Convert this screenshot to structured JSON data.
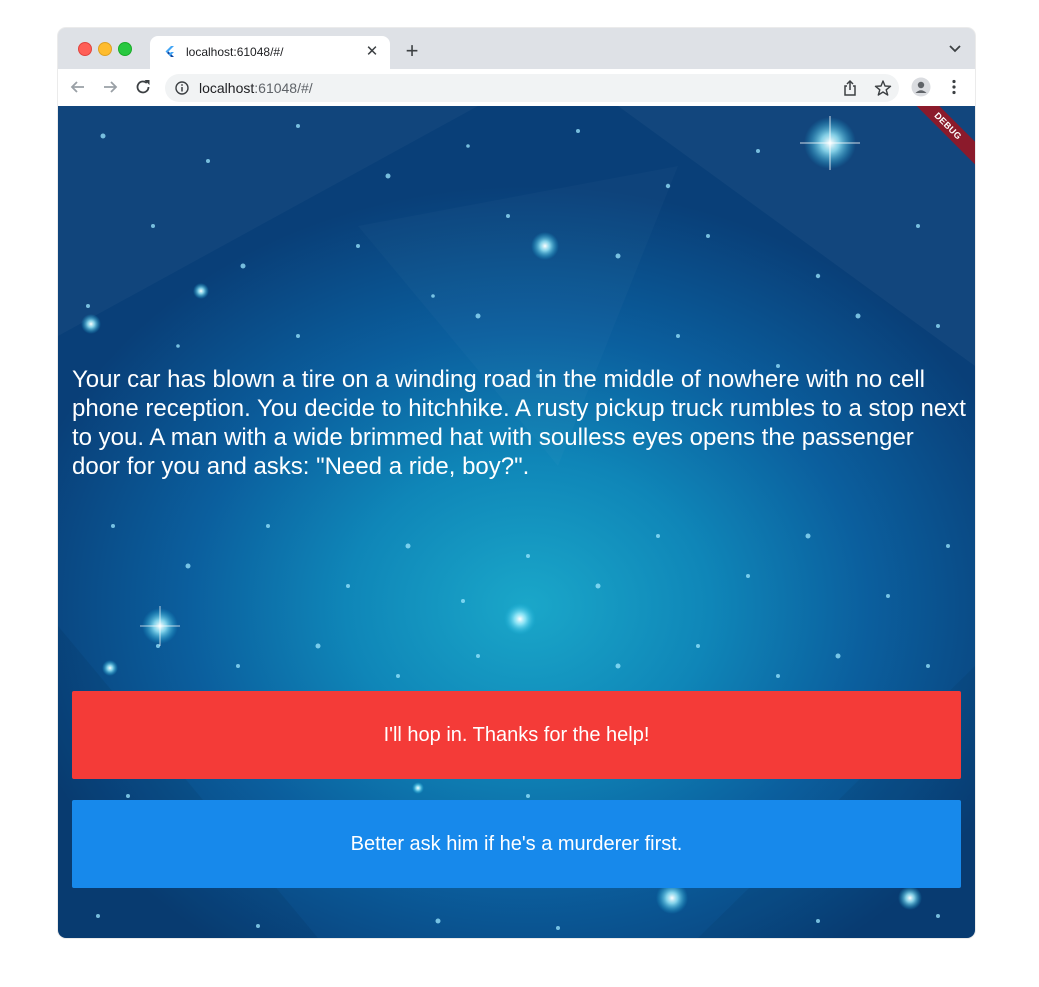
{
  "browser": {
    "tab_title": "localhost:61048/#/",
    "url_host": "localhost",
    "url_rest": ":61048/#/",
    "close_glyph": "✕",
    "newtab_glyph": "+"
  },
  "app": {
    "debug_banner": "DEBUG",
    "story_text": "Your car has blown a tire on a winding road in the middle of nowhere with no cell phone reception. You decide to hitchhike. A rusty pickup truck rumbles to a stop next to you. A man with a wide brimmed hat with soulless eyes opens the passenger door for you and asks: \"Need a ride, boy?\".",
    "choice1": "I'll hop in. Thanks for the help!",
    "choice2": "Better ask him if he's a murderer first.",
    "colors": {
      "choice1_bg": "#f43b38",
      "choice2_bg": "#1789eb",
      "debug_banner_bg": "#8b1a2b"
    }
  },
  "icons": [
    "flutter-icon",
    "close-icon",
    "plus-icon",
    "chevron-down-icon",
    "back-arrow-icon",
    "forward-arrow-icon",
    "reload-icon",
    "info-icon",
    "share-icon",
    "star-icon",
    "profile-icon",
    "kebab-menu-icon"
  ]
}
